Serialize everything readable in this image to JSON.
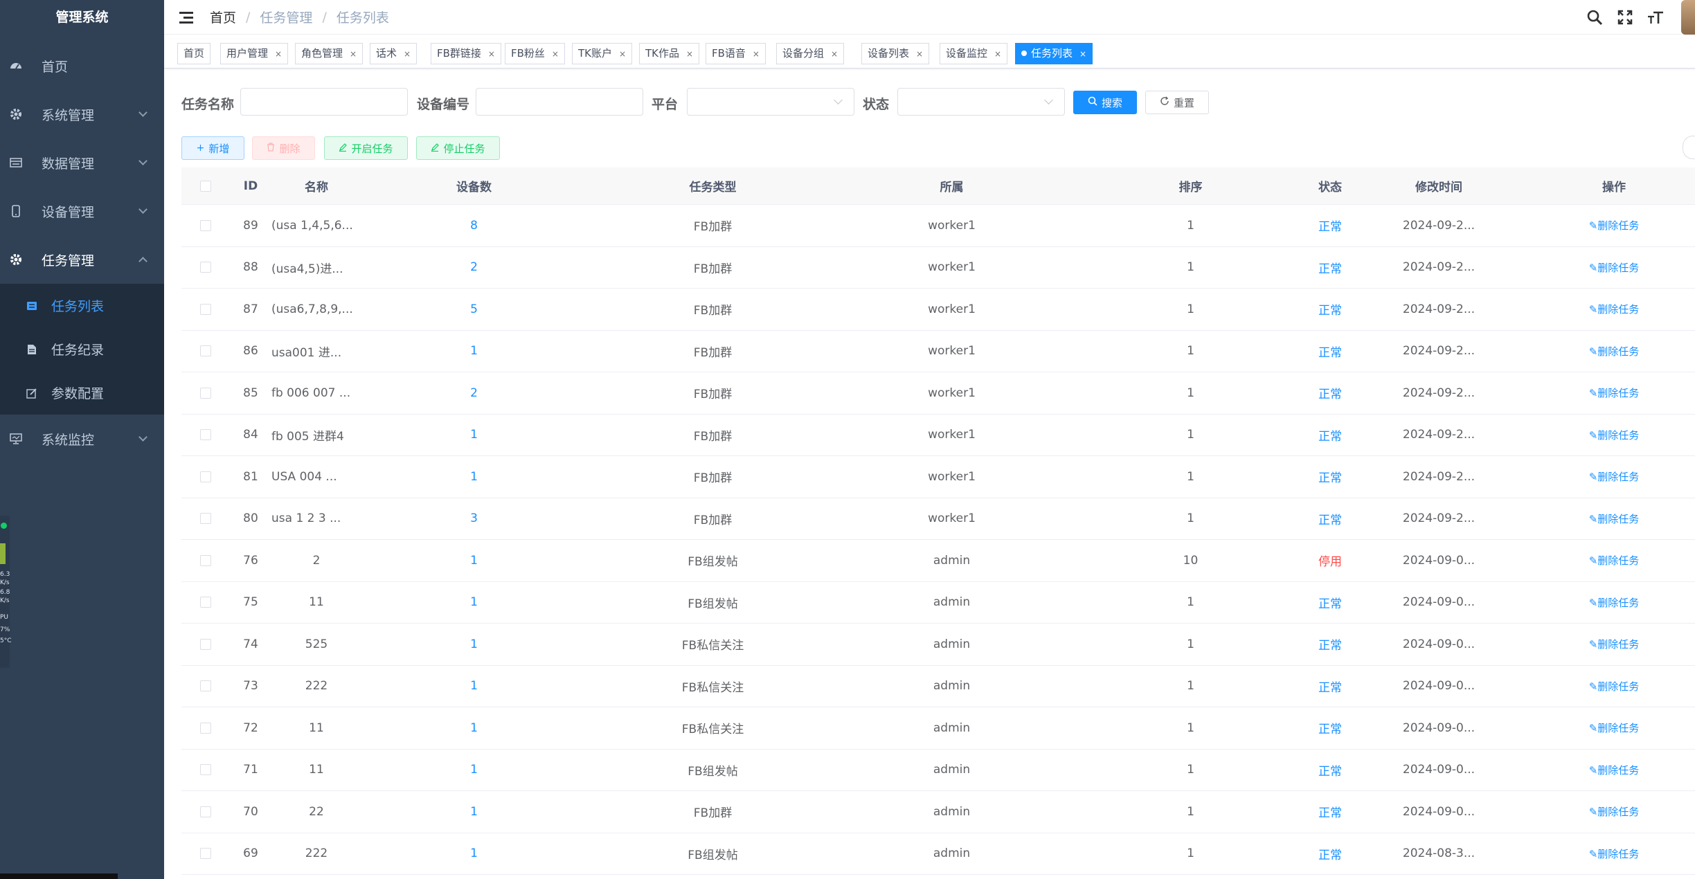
{
  "app": {
    "title": "管理系统"
  },
  "sidebar": {
    "items": [
      {
        "label": "首页",
        "icon": "dashboard-icon"
      },
      {
        "label": "系统管理",
        "icon": "gear-icon"
      },
      {
        "label": "数据管理",
        "icon": "database-icon"
      },
      {
        "label": "设备管理",
        "icon": "phone-icon"
      },
      {
        "label": "任务管理",
        "icon": "gear-icon"
      }
    ],
    "submenu": [
      {
        "label": "任务列表",
        "icon": "list-icon"
      },
      {
        "label": "任务纪录",
        "icon": "document-icon"
      },
      {
        "label": "参数配置",
        "icon": "edit-icon"
      }
    ],
    "monitor": {
      "label": "系统监控",
      "icon": "monitor-icon"
    },
    "widget": {
      "t1": "6.3",
      "t2": "K/s",
      "t3": "6.8",
      "t4": "K/s",
      "t5": "PU",
      "t6": "7%",
      "t7": "5°C"
    }
  },
  "header": {
    "breadcrumb": [
      "首页",
      "任务管理",
      "任务列表"
    ]
  },
  "tags": [
    {
      "label": "首页",
      "closable": false
    },
    {
      "label": "用户管理",
      "closable": true
    },
    {
      "label": "角色管理",
      "closable": true
    },
    {
      "label": "话术",
      "closable": true
    },
    {
      "label": "FB群链接",
      "closable": true
    },
    {
      "label": "FB粉丝",
      "closable": true
    },
    {
      "label": "TK账户",
      "closable": true
    },
    {
      "label": "TK作品",
      "closable": true
    },
    {
      "label": "FB语音",
      "closable": true
    },
    {
      "label": "设备分组",
      "closable": true
    },
    {
      "label": "设备列表",
      "closable": true
    },
    {
      "label": "设备监控",
      "closable": true
    },
    {
      "label": "任务列表",
      "closable": true,
      "active": true
    }
  ],
  "search": {
    "task_name_label": "任务名称",
    "device_no_label": "设备编号",
    "platform_label": "平台",
    "status_label": "状态",
    "search_btn": "搜索",
    "reset_btn": "重置"
  },
  "toolbar": {
    "add": "新增",
    "delete": "删除",
    "start": "开启任务",
    "stop": "停止任务"
  },
  "table": {
    "headers": [
      "ID",
      "名称",
      "设备数",
      "任务类型",
      "所属",
      "排序",
      "状态",
      "修改时间",
      "操作"
    ],
    "rows": [
      {
        "id": "89",
        "name": "(usa 1,4,5,6...",
        "dev": "8",
        "type": "FB加群",
        "owner": "worker1",
        "sort": "1",
        "status": "正常",
        "mtime": "2024-09-2...",
        "op": "删除任务"
      },
      {
        "id": "88",
        "name": "(usa4,5)进...",
        "dev": "2",
        "type": "FB加群",
        "owner": "worker1",
        "sort": "1",
        "status": "正常",
        "mtime": "2024-09-2...",
        "op": "删除任务"
      },
      {
        "id": "87",
        "name": "(usa6,7,8,9,...",
        "dev": "5",
        "type": "FB加群",
        "owner": "worker1",
        "sort": "1",
        "status": "正常",
        "mtime": "2024-09-2...",
        "op": "删除任务"
      },
      {
        "id": "86",
        "name": "usa001 进...",
        "dev": "1",
        "type": "FB加群",
        "owner": "worker1",
        "sort": "1",
        "status": "正常",
        "mtime": "2024-09-2...",
        "op": "删除任务"
      },
      {
        "id": "85",
        "name": "fb 006 007 ...",
        "dev": "2",
        "type": "FB加群",
        "owner": "worker1",
        "sort": "1",
        "status": "正常",
        "mtime": "2024-09-2...",
        "op": "删除任务"
      },
      {
        "id": "84",
        "name": "fb 005 进群4",
        "dev": "1",
        "type": "FB加群",
        "owner": "worker1",
        "sort": "1",
        "status": "正常",
        "mtime": "2024-09-2...",
        "op": "删除任务"
      },
      {
        "id": "81",
        "name": "USA 004 ...",
        "dev": "1",
        "type": "FB加群",
        "owner": "worker1",
        "sort": "1",
        "status": "正常",
        "mtime": "2024-09-2...",
        "op": "删除任务"
      },
      {
        "id": "80",
        "name": "usa 1 2 3 ...",
        "dev": "3",
        "type": "FB加群",
        "owner": "worker1",
        "sort": "1",
        "status": "正常",
        "mtime": "2024-09-2...",
        "op": "删除任务"
      },
      {
        "id": "76",
        "name": "2",
        "dev": "1",
        "type": "FB组发帖",
        "owner": "admin",
        "sort": "10",
        "status": "停用",
        "mtime": "2024-09-0...",
        "op": "删除任务"
      },
      {
        "id": "75",
        "name": "11",
        "dev": "1",
        "type": "FB组发帖",
        "owner": "admin",
        "sort": "1",
        "status": "正常",
        "mtime": "2024-09-0...",
        "op": "删除任务"
      },
      {
        "id": "74",
        "name": "525",
        "dev": "1",
        "type": "FB私信关注",
        "owner": "admin",
        "sort": "1",
        "status": "正常",
        "mtime": "2024-09-0...",
        "op": "删除任务"
      },
      {
        "id": "73",
        "name": "222",
        "dev": "1",
        "type": "FB私信关注",
        "owner": "admin",
        "sort": "1",
        "status": "正常",
        "mtime": "2024-09-0...",
        "op": "删除任务"
      },
      {
        "id": "72",
        "name": "11",
        "dev": "1",
        "type": "FB私信关注",
        "owner": "admin",
        "sort": "1",
        "status": "正常",
        "mtime": "2024-09-0...",
        "op": "删除任务"
      },
      {
        "id": "71",
        "name": "11",
        "dev": "1",
        "type": "FB组发帖",
        "owner": "admin",
        "sort": "1",
        "status": "正常",
        "mtime": "2024-09-0...",
        "op": "删除任务"
      },
      {
        "id": "70",
        "name": "22",
        "dev": "1",
        "type": "FB加群",
        "owner": "admin",
        "sort": "1",
        "status": "正常",
        "mtime": "2024-09-0...",
        "op": "删除任务"
      },
      {
        "id": "69",
        "name": "222",
        "dev": "1",
        "type": "FB组发帖",
        "owner": "admin",
        "sort": "1",
        "status": "正常",
        "mtime": "2024-08-3...",
        "op": "删除任务"
      }
    ]
  },
  "colors": {
    "sidebar_bg": "#304156",
    "accent": "#1890ff",
    "danger": "#ff4949"
  }
}
